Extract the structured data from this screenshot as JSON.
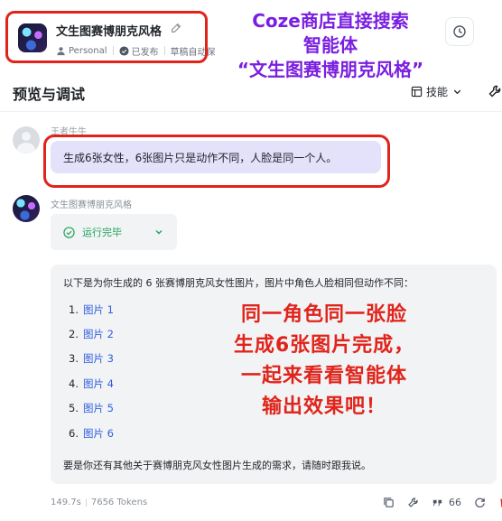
{
  "header": {
    "bot_title": "文生图赛博朋克风格",
    "meta": {
      "personal": "Personal",
      "published": "已发布",
      "draft_autosave": "草稿自动保"
    }
  },
  "overlay_annotation": {
    "line1": "Coze商店直接搜索",
    "line2": "智能体",
    "line3": "“文生图赛博朋克风格”"
  },
  "preview": {
    "title": "预览与调试",
    "skills_label": "技能"
  },
  "chat": {
    "user": {
      "name": "王者牛牛",
      "message": "生成6张女性，6张图片只是动作不同，人脸是同一个人。"
    },
    "bot": {
      "name": "文生图赛博朋克风格",
      "run_status": "运行完毕",
      "intro": "以下是为你生成的 6 张赛博朋克风女性图片，图片中角色人脸相同但动作不同：",
      "images": [
        {
          "num": "1.",
          "label": "图片 1"
        },
        {
          "num": "2.",
          "label": "图片 2"
        },
        {
          "num": "3.",
          "label": "图片 3"
        },
        {
          "num": "4.",
          "label": "图片 4"
        },
        {
          "num": "5.",
          "label": "图片 5"
        },
        {
          "num": "6.",
          "label": "图片 6"
        }
      ],
      "outro": "要是你还有其他关于赛博朋克风女性图片生成的需求，请随时跟我说。"
    }
  },
  "overlay_body": {
    "line1": "同一角色同一张脸",
    "line2": "生成6张图片完成，",
    "line3": "一起来看看智能体",
    "line4": "输出效果吧！"
  },
  "footer": {
    "duration": "149.7s",
    "tokens": "7656 Tokens",
    "count": "66"
  },
  "colors": {
    "annotation_red": "#e0241b",
    "annotation_purple": "#7a1fe0",
    "link_blue": "#2f5fe0",
    "success_green": "#1fa35a",
    "user_bubble": "#e4e1fb"
  }
}
